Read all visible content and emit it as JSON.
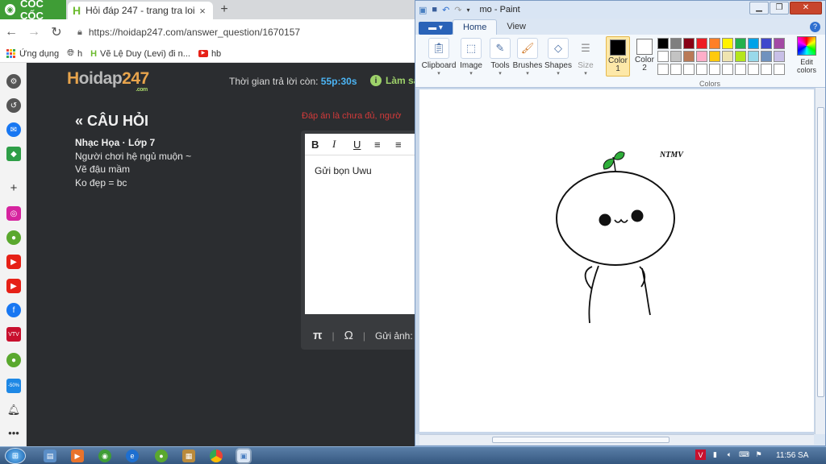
{
  "browser": {
    "brand": "CỐC CỐC",
    "tab_title": "Hỏi đáp 247 - trang tra loi",
    "tab_close": "×",
    "new_tab": "+",
    "url": "https://hoidap247.com/answer_question/1670157",
    "bookmarks": [
      "Ứng dụng",
      "h",
      "Vẽ Lệ Duy (Levi) đi n...",
      "hb"
    ]
  },
  "sidebar_icons": [
    "gear-icon",
    "history-icon",
    "messenger-icon",
    "game-icon",
    "plus-icon",
    "instagram-icon",
    "chat-icon",
    "youtube-icon",
    "youtube-icon",
    "facebook-icon",
    "vtv-icon",
    "chat-icon",
    "sale-icon",
    "bell-icon",
    "more-icon"
  ],
  "page": {
    "logo_main": "Hoidap247",
    "logo_sub": ".com",
    "timer_label": "Thời gian trả lời còn:",
    "timer_value": "55p:30s",
    "lam_sai": "Làm sa",
    "question_heading": "CÂU HỎI",
    "question_meta": "Nhạc Họa · Lớp 7",
    "question_lines": [
      "Người chơi hệ ngủ muộn ~",
      "Vẽ đậu mầm",
      "Ko đẹp = bc"
    ],
    "red_text": "Đáp án là chưa đủ, ngườ",
    "editor_text": "Gửi bọn Uwu",
    "editor_toolbar": [
      "B",
      "I",
      "U",
      "≡",
      "≡"
    ],
    "editor_pi": "π",
    "editor_omega": "Ω",
    "send_image": "Gửi ảnh:"
  },
  "paint": {
    "title": "mo - Paint",
    "file_menu": "▬ ▾",
    "tabs": [
      "Home",
      "View"
    ],
    "groups": [
      "Clipboard",
      "Image",
      "Tools",
      "Brushes",
      "Shapes",
      "Size"
    ],
    "color1_label": "Color\n1",
    "color2_label": "Color\n2",
    "colors_label": "Colors",
    "edit_colors": "Edit colors",
    "color1": "#000000",
    "color2": "#ffffff",
    "palette": [
      "#000000",
      "#7f7f7f",
      "#880015",
      "#ed1c24",
      "#ff7f27",
      "#fff200",
      "#22b14c",
      "#00a2e8",
      "#3f48cc",
      "#a349a4",
      "#ffffff",
      "#c3c3c3",
      "#b97a57",
      "#ffaec9",
      "#ffc90e",
      "#efe4b0",
      "#b5e61d",
      "#99d9ea",
      "#7092be",
      "#c8bfe7",
      "#ffffff",
      "#ffffff",
      "#ffffff",
      "#ffffff",
      "#ffffff",
      "#ffffff",
      "#ffffff",
      "#ffffff",
      "#ffffff",
      "#ffffff"
    ],
    "canvas_signature": "NTMV"
  },
  "taskbar": {
    "clock": "11:56 SA"
  }
}
